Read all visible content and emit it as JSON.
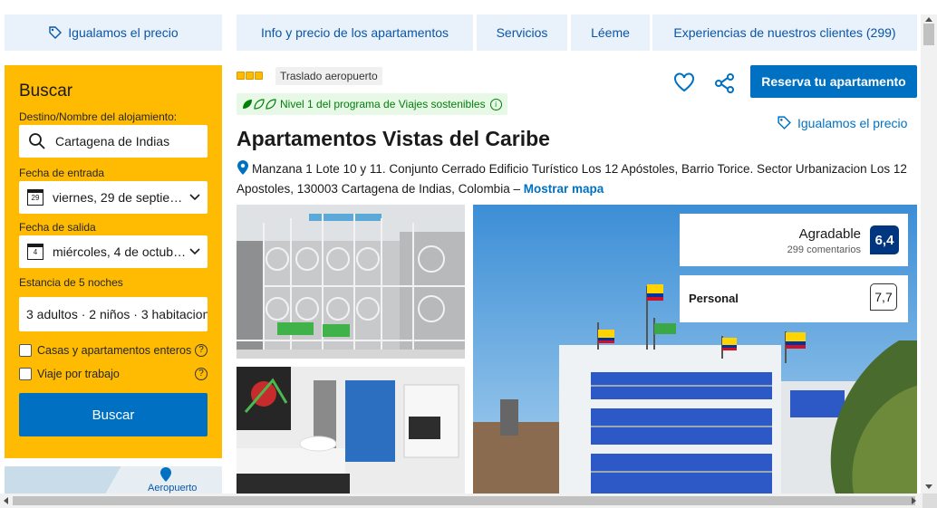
{
  "tabs": {
    "price_match": "Igualamos el precio",
    "info": "Info y precio de los apartamentos",
    "services": "Servicios",
    "readme": "Léeme",
    "reviews": "Experiencias de nuestros clientes (299)"
  },
  "search": {
    "title": "Buscar",
    "destination_label": "Destino/Nombre del alojamiento:",
    "destination_value": "Cartagena de Indias",
    "checkin_label": "Fecha de entrada",
    "checkin_value": "viernes, 29 de septie…",
    "checkin_day": "29",
    "checkout_label": "Fecha de salida",
    "checkout_value": "miércoles, 4 de octub…",
    "checkout_day": "4",
    "stay_label": "Estancia de 5 noches",
    "guests_value": "3 adultos · 2 niños · 3 habitacion",
    "whole_homes": "Casas y apartamentos enteros",
    "work_trip": "Viaje por trabajo",
    "button": "Buscar"
  },
  "map": {
    "label": "Aeropuerto"
  },
  "property": {
    "shuttle_badge": "Traslado aeropuerto",
    "eco_badge": "Nivel 1 del programa de Viajes sostenibles",
    "name": "Apartamentos Vistas del Caribe",
    "address": "Manzana 1 Lote 10 y 11. Conjunto Cerrado Edificio Turístico Los 12 Apóstoles, Barrio Torice. Sector Urbanizacion Los 12 Apostoles, 130003 Cartagena de Indias, Colombia –",
    "show_map": "Mostrar mapa",
    "reserve_button": "Reserva tu apartamento",
    "price_match": "Igualamos el precio"
  },
  "review": {
    "label": "Agradable",
    "count": "299 comentarios",
    "score": "6,4",
    "staff_label": "Personal",
    "staff_score": "7,7"
  },
  "colors": {
    "brand_blue": "#0071c2",
    "yellow": "#febb02",
    "dark_blue": "#003580",
    "eco_green": "#008009"
  }
}
